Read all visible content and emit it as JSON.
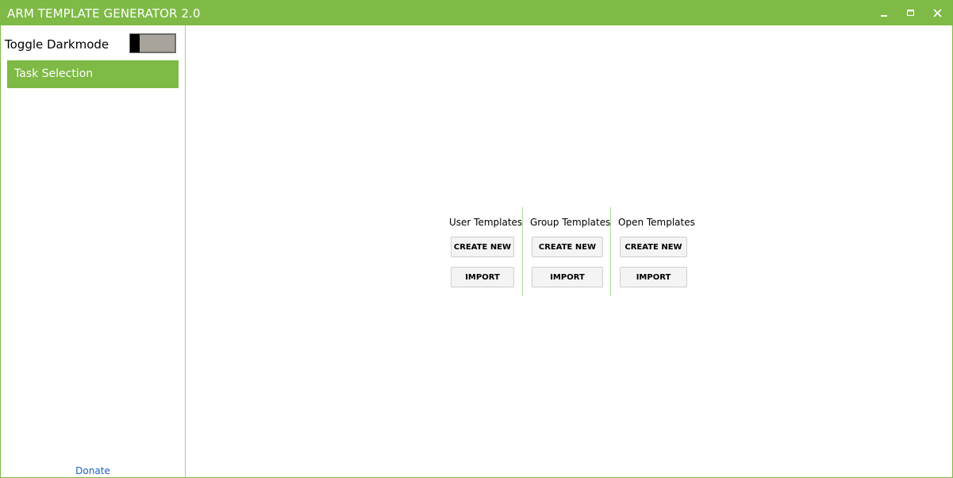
{
  "window": {
    "title": "ARM TEMPLATE GENERATOR 2.0",
    "accent_color": "#7eba45",
    "controls": [
      "minimize-icon",
      "maximize-icon",
      "close-icon"
    ]
  },
  "sidebar": {
    "toggle_label": "Toggle Darkmode",
    "toggle_state": "off",
    "items": [
      {
        "label": "Task Selection",
        "selected": true
      }
    ],
    "donate_label": "Donate"
  },
  "main": {
    "groups": [
      {
        "title": "User Templates",
        "create_label": "CREATE NEW",
        "import_label": "IMPORT"
      },
      {
        "title": "Group Templates",
        "create_label": "CREATE NEW",
        "import_label": "IMPORT"
      },
      {
        "title": "Open Templates",
        "create_label": "CREATE NEW",
        "import_label": "IMPORT"
      }
    ]
  }
}
